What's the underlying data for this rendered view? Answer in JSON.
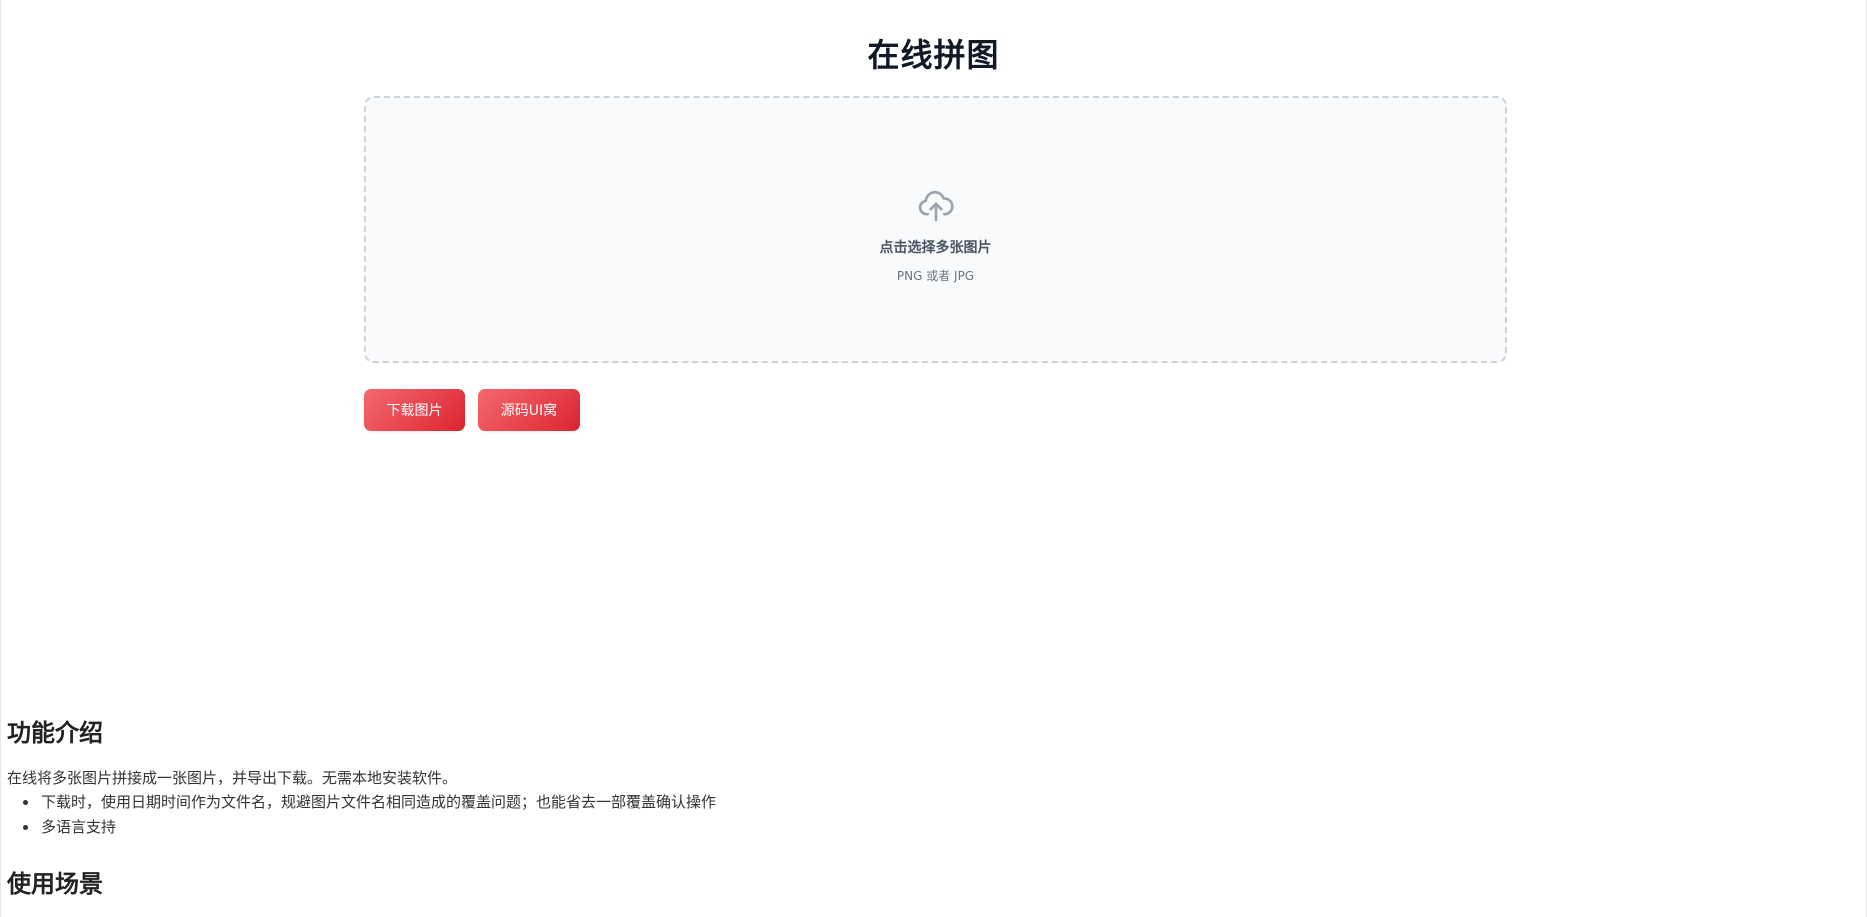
{
  "page": {
    "title": "在线拼图"
  },
  "upload": {
    "icon": "cloud-upload-icon",
    "main_text": "点击选择多张图片",
    "sub_text": "PNG 或者 JPG"
  },
  "actions": {
    "download_label": "下载图片",
    "source_label": "源码UI窝"
  },
  "colors": {
    "button_gradient_start": "#f46a6f",
    "button_gradient_end": "#dc2430",
    "upload_background": "#f9fafb",
    "upload_border": "#cfd3d9",
    "title": "#111827"
  },
  "features": {
    "heading": "功能介绍",
    "description": "在线将多张图片拼接成一张图片，并导出下载。无需本地安装软件。",
    "items": [
      "下载时，使用日期时间作为文件名，规避图片文件名相同造成的覆盖问题；也能省去一部覆盖确认操作",
      "多语言支持"
    ]
  },
  "scenarios": {
    "heading": "使用场景"
  }
}
